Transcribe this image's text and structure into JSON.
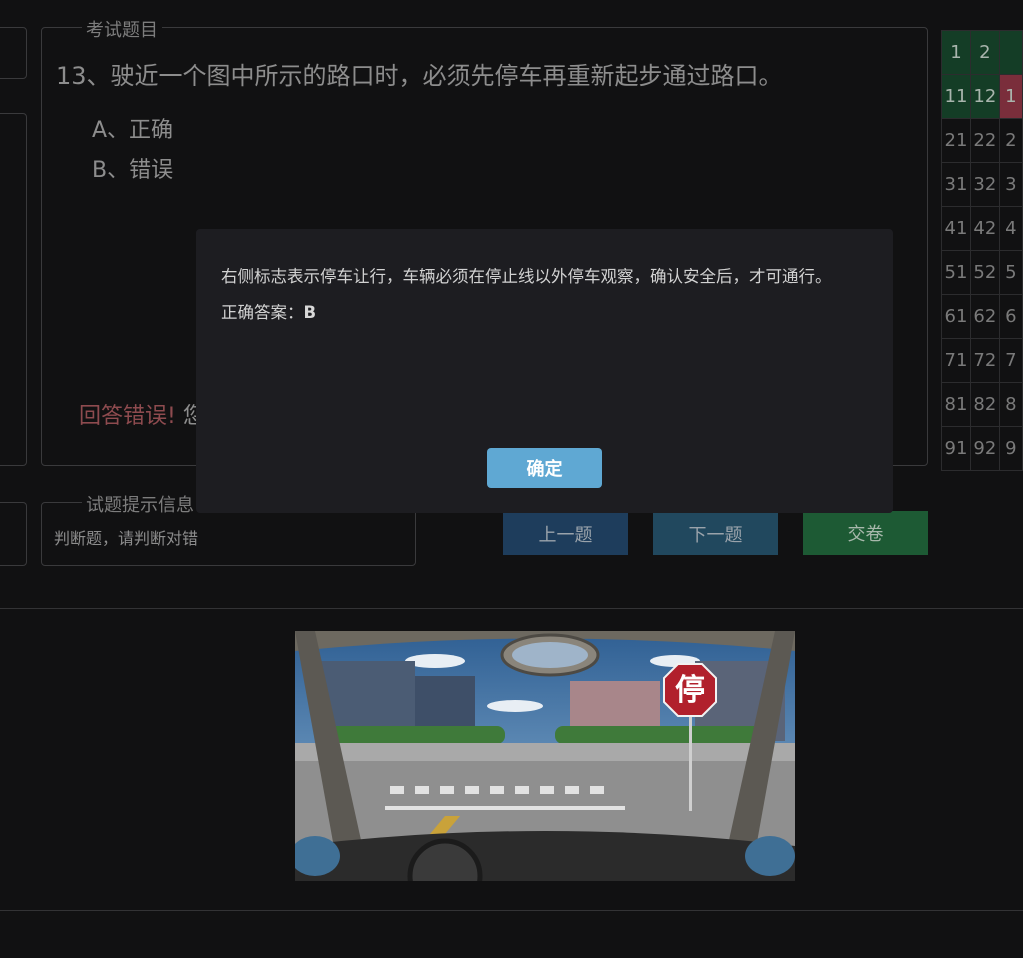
{
  "question_panel": {
    "legend": "考试题目",
    "question": "13、驶近一个图中所示的路口时，必须先停车再重新起步通过路口。",
    "options": [
      "A、正确",
      "B、错误"
    ],
    "result_wrong": "回答错误!",
    "result_extra": "您"
  },
  "hint_panel": {
    "legend": "试题提示信息",
    "text": "判断题，请判断对错"
  },
  "buttons": {
    "prev": "上一题",
    "next": "下一题",
    "submit": "交卷"
  },
  "answer_grid": {
    "rows": [
      [
        {
          "n": "1",
          "s": "correct"
        },
        {
          "n": "2",
          "s": "correct"
        },
        {
          "n": "",
          "s": "correct"
        }
      ],
      [
        {
          "n": "11",
          "s": "correct"
        },
        {
          "n": "12",
          "s": "correct"
        },
        {
          "n": "1",
          "s": "wrong"
        }
      ],
      [
        {
          "n": "21",
          "s": ""
        },
        {
          "n": "22",
          "s": ""
        },
        {
          "n": "2",
          "s": ""
        }
      ],
      [
        {
          "n": "31",
          "s": ""
        },
        {
          "n": "32",
          "s": ""
        },
        {
          "n": "3",
          "s": ""
        }
      ],
      [
        {
          "n": "41",
          "s": ""
        },
        {
          "n": "42",
          "s": ""
        },
        {
          "n": "4",
          "s": ""
        }
      ],
      [
        {
          "n": "51",
          "s": ""
        },
        {
          "n": "52",
          "s": ""
        },
        {
          "n": "5",
          "s": ""
        }
      ],
      [
        {
          "n": "61",
          "s": ""
        },
        {
          "n": "62",
          "s": ""
        },
        {
          "n": "6",
          "s": ""
        }
      ],
      [
        {
          "n": "71",
          "s": ""
        },
        {
          "n": "72",
          "s": ""
        },
        {
          "n": "7",
          "s": ""
        }
      ],
      [
        {
          "n": "81",
          "s": ""
        },
        {
          "n": "82",
          "s": ""
        },
        {
          "n": "8",
          "s": ""
        }
      ],
      [
        {
          "n": "91",
          "s": ""
        },
        {
          "n": "92",
          "s": ""
        },
        {
          "n": "9",
          "s": ""
        }
      ]
    ]
  },
  "scene": {
    "sign_text": "停"
  },
  "modal": {
    "explanation": "右侧标志表示停车让行，车辆必须在停止线以外停车观察，确认安全后，才可通行。",
    "answer_label": "正确答案：",
    "answer_value": "B",
    "ok_label": "确定"
  },
  "colors": {
    "background": "#111112",
    "modal_bg": "#1d1d21",
    "ok_button": "#5fa8d3",
    "correct_cell": "#143d26",
    "wrong_cell": "#7a2e3b",
    "error_text": "#8e4b4f"
  }
}
